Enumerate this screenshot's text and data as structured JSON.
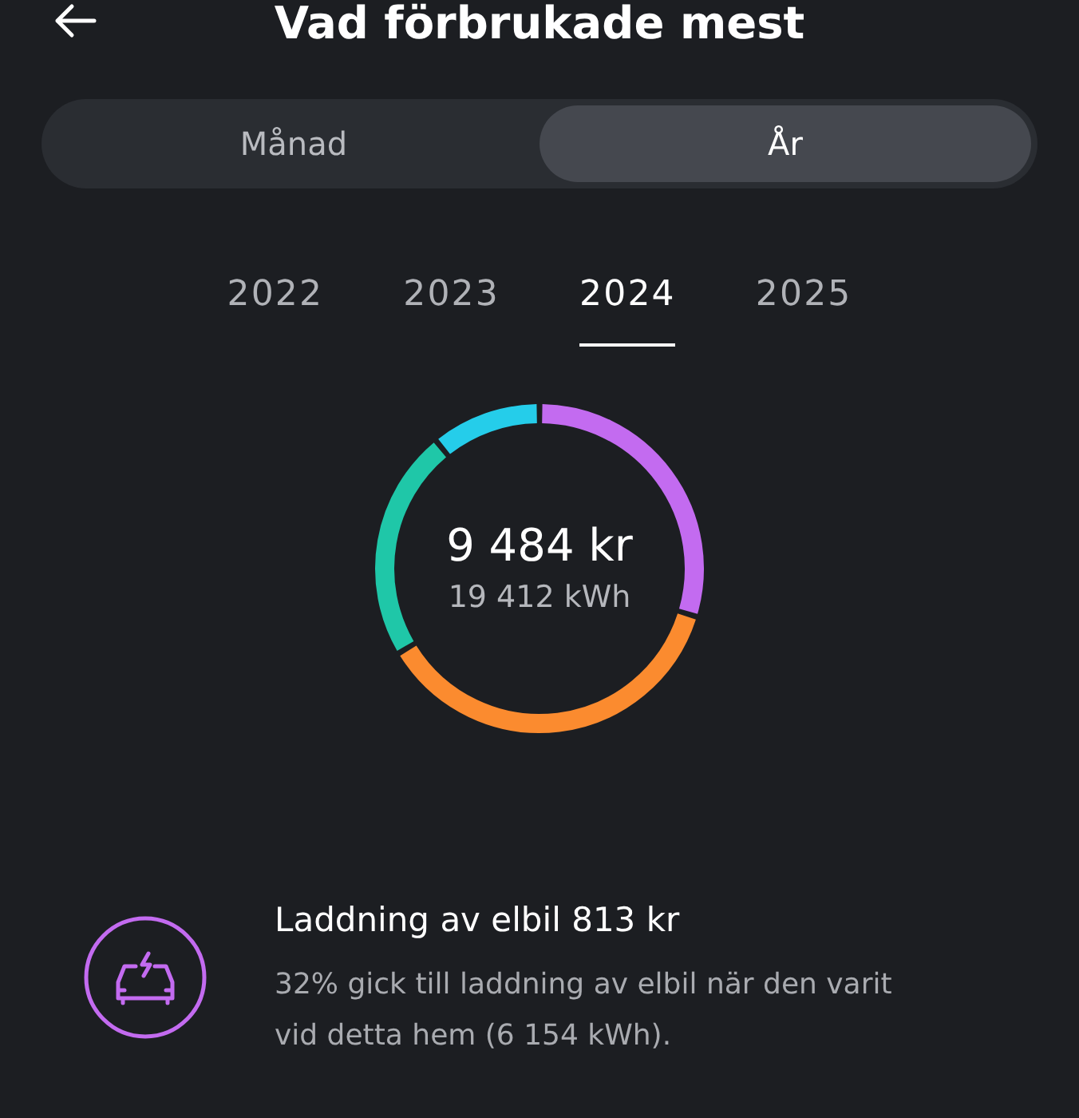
{
  "header": {
    "title": "Vad förbrukade mest"
  },
  "period_tabs": [
    {
      "label": "Månad",
      "selected": false
    },
    {
      "label": "År",
      "selected": true
    }
  ],
  "years": [
    {
      "label": "2022",
      "selected": false
    },
    {
      "label": "2023",
      "selected": false
    },
    {
      "label": "2024",
      "selected": true
    },
    {
      "label": "2025",
      "selected": false
    }
  ],
  "summary": {
    "cost": "9 484 kr",
    "energy": "19 412 kWh"
  },
  "category": {
    "title": "Laddning av elbil 813 kr",
    "description": "32% gick till laddning av elbil när den varit vid detta hem (6 154 kWh).",
    "color": "#c36bf0"
  }
}
